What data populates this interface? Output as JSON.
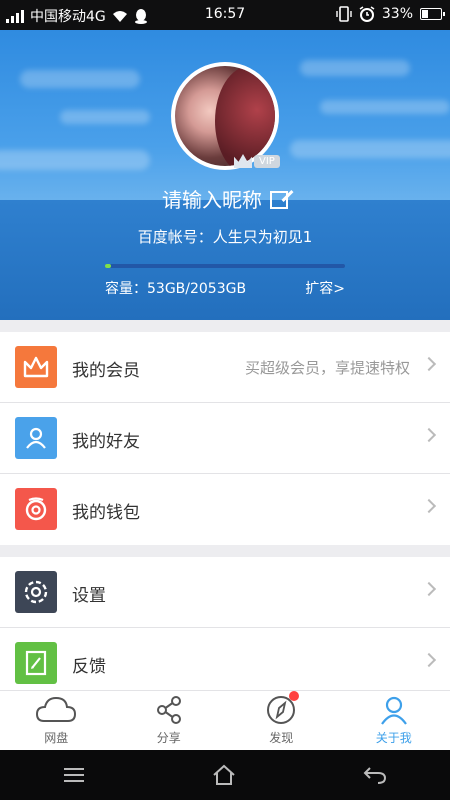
{
  "status_bar": {
    "carrier": "中国移动4G",
    "time": "16:57",
    "battery_text": "33%",
    "battery_level": 0.33
  },
  "profile": {
    "vip_label": "VIP",
    "nickname": "请输入昵称",
    "account": "百度帐号：人生只为初见1",
    "storage_used_fraction": 0.026,
    "capacity": "容量：53GB/2053GB",
    "expand_label": "扩容>"
  },
  "menu": {
    "vip": {
      "label": "我的会员",
      "sub": "买超级会员，享提速特权",
      "color": "#f5783c"
    },
    "friends": {
      "label": "我的好友",
      "color": "#4aa2ea"
    },
    "wallet": {
      "label": "我的钱包",
      "color": "#f4574b"
    },
    "settings": {
      "label": "设置",
      "color": "#3d4656"
    },
    "feedback": {
      "label": "反馈",
      "color": "#62c044"
    }
  },
  "tabs": [
    {
      "label": "网盘",
      "icon": "cloud-icon"
    },
    {
      "label": "分享",
      "icon": "share-icon"
    },
    {
      "label": "发现",
      "icon": "compass-icon"
    },
    {
      "label": "关于我",
      "icon": "person-icon"
    }
  ],
  "colors": {
    "accent": "#3ea0ea",
    "progress": "#7fe04a"
  }
}
